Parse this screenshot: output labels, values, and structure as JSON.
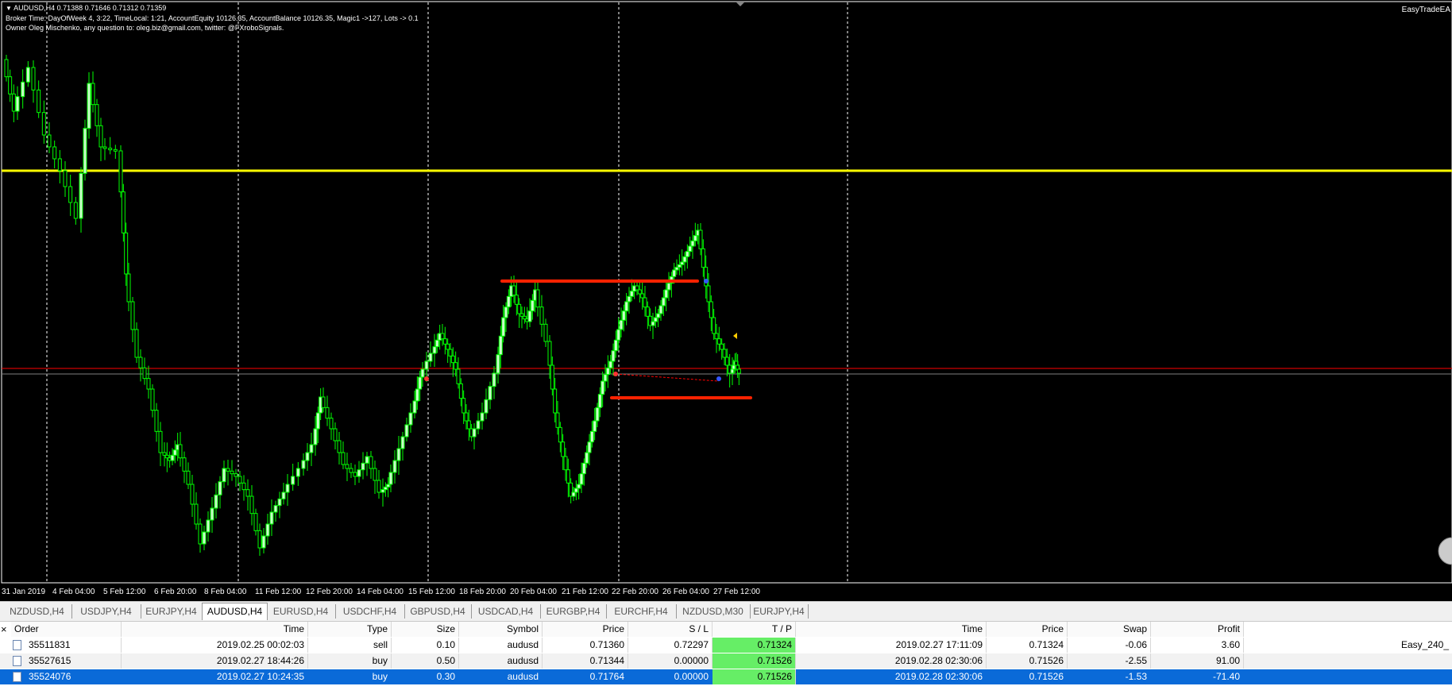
{
  "chart": {
    "header": "AUDUSD,H4  0.71388 0.71646 0.71312 0.71359",
    "info_line1": "Broker Time: DayOfWeek 4, 3:22, TimeLocal: 1:21, AccountEquity 10126.35, AccountBalance 10126.35, Magic1 ->127, Lots -> 0.1",
    "info_line2": "Owner Oleg Mischenko, any question to: oleg.biz@gmail.com, twitter: @FXroboSignals.",
    "ea_name": "EasyTradeEA",
    "time_labels": [
      "31 Jan 2019",
      "4 Feb 04:00",
      "5 Feb 12:00",
      "6 Feb 20:00",
      "8 Feb 04:00",
      "11 Feb 12:00",
      "12 Feb 20:00",
      "14 Feb 04:00",
      "15 Feb 12:00",
      "18 Feb 20:00",
      "20 Feb 04:00",
      "21 Feb 12:00",
      "22 Feb 20:00",
      "26 Feb 04:00",
      "27 Feb 12:00"
    ],
    "colors": {
      "background": "#000000",
      "bull_body": "#c8ffc8",
      "wick": "#00ff00",
      "yellow_line": "#ffff00",
      "red_level": "#ff2200",
      "bid_line": "#ff0000",
      "ask_line": "#808080"
    }
  },
  "tabs": [
    "NZDUSD,H4",
    "USDJPY,H4",
    "EURJPY,H4",
    "AUDUSD,H4",
    "EURUSD,H4",
    "USDCHF,H4",
    "GBPUSD,H4",
    "USDCAD,H4",
    "EURGBP,H4",
    "EURCHF,H4",
    "NZDUSD,M30",
    "EURJPY,H4"
  ],
  "active_tab": "AUDUSD,H4",
  "table": {
    "close": "×",
    "headers": [
      "Order",
      "Time",
      "Type",
      "Size",
      "Symbol",
      "Price",
      "S / L",
      "T / P",
      "Time",
      "Price",
      "Swap",
      "Profit"
    ],
    "rows": [
      {
        "order": "35511831",
        "time": "2019.02.25 00:02:03",
        "type": "sell",
        "size": "0.10",
        "symbol": "audusd",
        "price": "0.71360",
        "sl": "0.72297",
        "tp": "0.71324",
        "close_time": "2019.02.27 17:11:09",
        "close_price": "0.71324",
        "swap": "-0.06",
        "profit": "3.60",
        "comment": "Easy_240_"
      },
      {
        "order": "35527615",
        "time": "2019.02.27 18:44:26",
        "type": "buy",
        "size": "0.50",
        "symbol": "audusd",
        "price": "0.71344",
        "sl": "0.00000",
        "tp": "0.71526",
        "close_time": "2019.02.28 02:30:06",
        "close_price": "0.71526",
        "swap": "-2.55",
        "profit": "91.00",
        "comment": ""
      },
      {
        "order": "35524076",
        "time": "2019.02.27 10:24:35",
        "type": "buy",
        "size": "0.30",
        "symbol": "audusd",
        "price": "0.71764",
        "sl": "0.00000",
        "tp": "0.71526",
        "close_time": "2019.02.28 02:30:06",
        "close_price": "0.71526",
        "swap": "-1.53",
        "profit": "-71.40",
        "comment": ""
      }
    ]
  }
}
